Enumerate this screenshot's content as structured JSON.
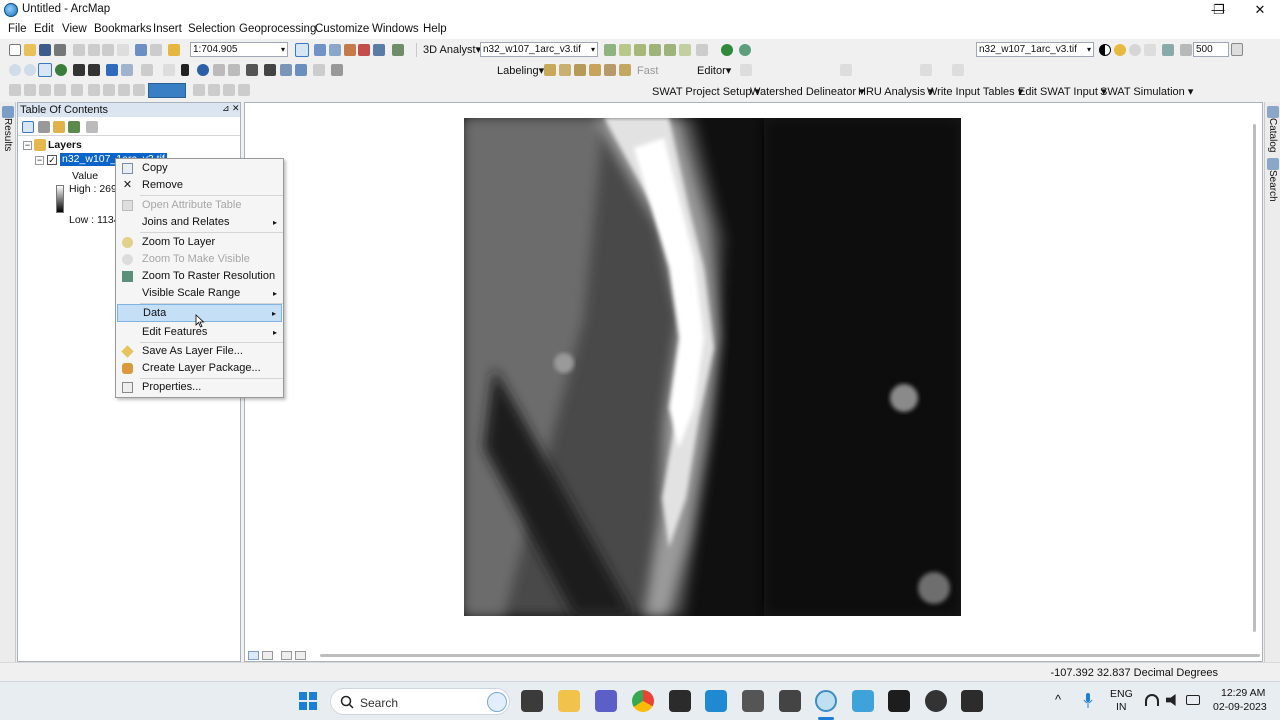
{
  "window": {
    "title": "Untitled - ArcMap",
    "minimize": "—",
    "maximize": "❐",
    "close": "✕"
  },
  "menu": [
    "File",
    "Edit",
    "View",
    "Bookmarks",
    "Insert",
    "Selection",
    "Geoprocessing",
    "Customize",
    "Windows",
    "Help"
  ],
  "toolbar": {
    "scale": "1:704.905",
    "analyst_label": "3D Analyst▾",
    "layer_combo": "n32_w107_1arc_v3.tif",
    "layer_combo_right": "n32_w107_1arc_v3.tif",
    "zoom_value": "500",
    "labeling": "Labeling▾",
    "fast": "Fast",
    "editor": "Editor▾",
    "swat_items": [
      "SWAT Project Setup ▾",
      "Watershed Delineator ▾",
      "HRU Analysis ▾",
      "Write Input Tables ▾",
      "Edit SWAT Input ▾",
      "SWAT Simulation ▾"
    ]
  },
  "toc": {
    "title": "Table Of Contents",
    "pin": "⊿",
    "close": "✕",
    "layers_label": "Layers",
    "layer_name": "n32_w107_1arc_v3.tif",
    "legend_title": "Value",
    "high": "High : 2690",
    "low": "Low : 1134"
  },
  "side": {
    "left": "Results",
    "right_catalog": "Catalog",
    "right_search": "Search"
  },
  "context_menu": {
    "items": [
      {
        "label": "Copy",
        "enabled": true,
        "submenu": false,
        "icon": "copy-icon"
      },
      {
        "label": "Remove",
        "enabled": true,
        "submenu": false,
        "icon": "remove-icon"
      },
      {
        "label": "Open Attribute Table",
        "enabled": false,
        "submenu": false,
        "icon": "table-icon"
      },
      {
        "label": "Joins and Relates",
        "enabled": true,
        "submenu": true,
        "icon": ""
      },
      {
        "label": "Zoom To Layer",
        "enabled": true,
        "submenu": false,
        "icon": "zoom-layer-icon"
      },
      {
        "label": "Zoom To Make Visible",
        "enabled": false,
        "submenu": false,
        "icon": "zoom-visible-icon"
      },
      {
        "label": "Zoom To Raster Resolution",
        "enabled": true,
        "submenu": false,
        "icon": "raster-resolution-icon"
      },
      {
        "label": "Visible Scale Range",
        "enabled": true,
        "submenu": true,
        "icon": ""
      },
      {
        "label": "Data",
        "enabled": true,
        "submenu": true,
        "icon": "",
        "highlighted": true
      },
      {
        "label": "Edit Features",
        "enabled": true,
        "submenu": true,
        "icon": ""
      },
      {
        "label": "Save As Layer File...",
        "enabled": true,
        "submenu": false,
        "icon": "layer-file-icon"
      },
      {
        "label": "Create Layer Package...",
        "enabled": true,
        "submenu": false,
        "icon": "package-icon"
      },
      {
        "label": "Properties...",
        "enabled": true,
        "submenu": false,
        "icon": "properties-icon"
      }
    ],
    "submenu_arrow": "▸"
  },
  "status": {
    "coords": "-107.392  32.837 Decimal Degrees"
  },
  "taskbar": {
    "search": "Search",
    "lang_top": "ENG",
    "lang_bottom": "IN",
    "time": "12:29 AM",
    "date": "02-09-2023",
    "chevron": "^"
  },
  "colors": {
    "selection_blue": "#0a64c9",
    "menu_highlight": "#c5dff6",
    "toc_header": "#dbe5f1"
  }
}
